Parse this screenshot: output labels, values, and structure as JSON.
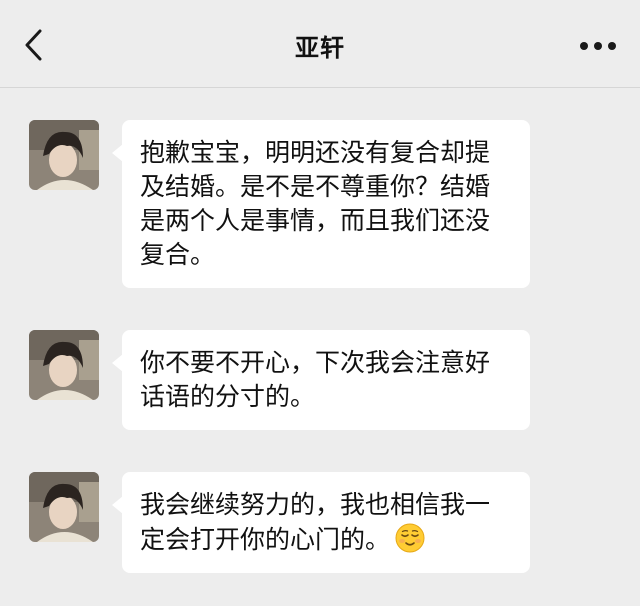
{
  "header": {
    "title": "亚轩",
    "back_icon": "chevron-left-icon",
    "more_icon": "more-horizontal-icon"
  },
  "messages": [
    {
      "text": "抱歉宝宝，明明还没有复合却提及结婚。是不是不尊重你？结婚是两个人是事情，而且我们还没复合。"
    },
    {
      "text": "你不要不开心，下次我会注意好话语的分寸的。"
    },
    {
      "text": "我会继续努力的，我也相信我一定会打开你的心门的。",
      "emoji": "relieved-face-emoji"
    }
  ],
  "colors": {
    "background": "#ededed",
    "bubble": "#ffffff",
    "text": "#111111"
  }
}
